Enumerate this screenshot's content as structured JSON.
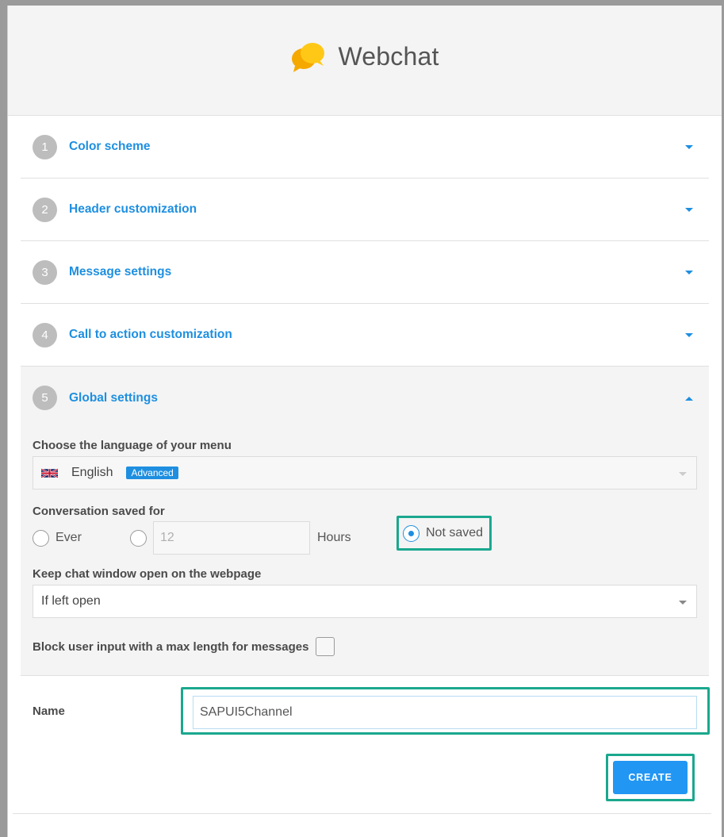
{
  "modal": {
    "title": "Webchat"
  },
  "sections": [
    {
      "number": "1",
      "title": "Color scheme"
    },
    {
      "number": "2",
      "title": "Header customization"
    },
    {
      "number": "3",
      "title": "Message settings"
    },
    {
      "number": "4",
      "title": "Call to action customization"
    },
    {
      "number": "5",
      "title": "Global settings"
    }
  ],
  "global_settings": {
    "language_label": "Choose the language of your menu",
    "language_value": "English",
    "language_badge": "Advanced",
    "conversation_label": "Conversation saved for",
    "option_ever": "Ever",
    "hours_value": "12",
    "hours_unit": "Hours",
    "option_not_saved": "Not saved",
    "selected_option": "Not saved",
    "keep_open_label": "Keep chat window open on the webpage",
    "keep_open_value": "If left open",
    "block_input_label": "Block user input with a max length for messages"
  },
  "name_field": {
    "label": "Name",
    "value": "SAPUI5Channel"
  },
  "create_button": "CREATE",
  "colors": {
    "accent": "#1e8fe0",
    "highlight": "#1aa88e",
    "button": "#2296f3"
  }
}
